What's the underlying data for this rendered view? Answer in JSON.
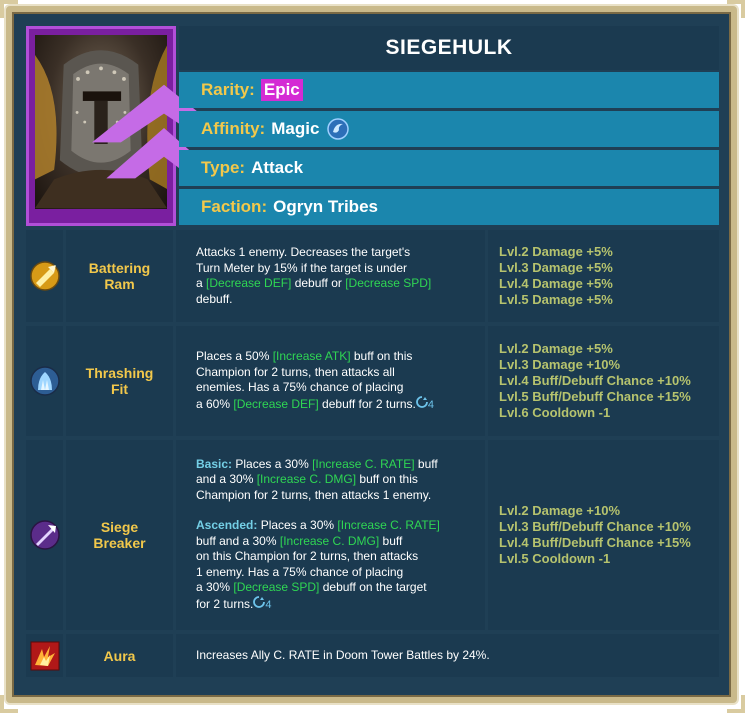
{
  "champion": {
    "name": "SIEGEHULK",
    "rarity_label": "Rarity:",
    "rarity": "Epic",
    "affinity_label": "Affinity:",
    "affinity": "Magic",
    "affinity_icon": "magic-affinity-icon",
    "type_label": "Type:",
    "type": "Attack",
    "faction_label": "Faction:",
    "faction": "Ogryn Tribes"
  },
  "colors": {
    "panel": "#1b3a50",
    "info_row": "#1b86ad",
    "gold": "#f2c84b",
    "epic": "#d42bd4",
    "buff_green": "#2fd653",
    "level_text": "#b6c36e"
  },
  "skills": [
    {
      "name_line1": "Battering",
      "name_line2": "Ram",
      "icon": "battering-ram-icon",
      "desc": {
        "l1": "Attacks 1 enemy. Decreases the target's",
        "l2": "Turn Meter by 15% if the target is under",
        "l3a": "a ",
        "l3b": "[Decrease DEF]",
        "l3c": " debuff or ",
        "l3d": "[Decrease SPD]",
        "l4": "debuff."
      },
      "levels": [
        "Lvl.2 Damage +5%",
        "Lvl.3 Damage +5%",
        "Lvl.4 Damage +5%",
        "Lvl.5 Damage +5%"
      ]
    },
    {
      "name_line1": "Thrashing",
      "name_line2": "Fit",
      "icon": "thrashing-fit-icon",
      "cooldown": "4",
      "desc": {
        "l1a": "Places a 50% ",
        "l1b": "[Increase ATK]",
        "l1c": " buff on this",
        "l2": "Champion for 2 turns, then attacks all",
        "l3": "enemies. Has a 75% chance of placing",
        "l4a": "a 60% ",
        "l4b": "[Decrease DEF]",
        "l4c": " debuff for 2 turns."
      },
      "levels": [
        "Lvl.2 Damage +5%",
        "Lvl.3 Damage +10%",
        "Lvl.4 Buff/Debuff Chance +10%",
        "Lvl.5 Buff/Debuff Chance +15%",
        "Lvl.6 Cooldown -1"
      ]
    },
    {
      "name_line1": "Siege",
      "name_line2": "Breaker",
      "icon": "siege-breaker-icon",
      "cooldown": "4",
      "desc": {
        "basic_label": "Basic:",
        "b1a": " Places a 30% ",
        "b1b": "[Increase C. RATE]",
        "b1c": " buff",
        "b2a": "and a 30% ",
        "b2b": "[Increase C. DMG]",
        "b2c": " buff on this",
        "b3": "Champion for 2 turns, then attacks 1 enemy.",
        "ascended_label": "Ascended:",
        "a1a": " Places a 30% ",
        "a1b": "[Increase C. RATE]",
        "a2a": "buff and a 30% ",
        "a2b": "[Increase C. DMG]",
        "a2c": " buff",
        "a3": "on this Champion for 2 turns, then attacks",
        "a4": "1 enemy. Has a 75% chance of placing",
        "a5a": "a 30% ",
        "a5b": "[Decrease SPD]",
        "a5c": " debuff on the target",
        "a6": "for 2 turns."
      },
      "levels": [
        "Lvl.2 Damage +10%",
        "Lvl.3 Buff/Debuff Chance +10%",
        "Lvl.4 Buff/Debuff Chance +15%",
        "Lvl.5 Cooldown -1"
      ]
    }
  ],
  "aura": {
    "name": "Aura",
    "icon": "aura-icon",
    "desc": "Increases Ally C. RATE in Doom Tower Battles by 24%."
  }
}
